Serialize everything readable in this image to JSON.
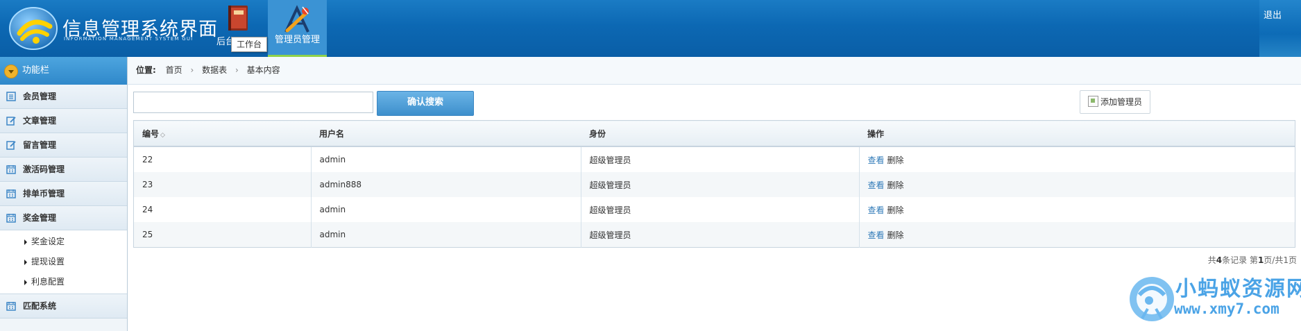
{
  "header": {
    "title": "信息管理系统界面",
    "subtitle": "INFORMATION MANAGEMENT SYSTEM GUI",
    "nav": [
      {
        "label": "后台",
        "icon": "book-icon"
      },
      {
        "label": "管理员管理",
        "icon": "tools-icon",
        "active": true
      }
    ],
    "tooltip": "工作台",
    "logout": "退出"
  },
  "sidebar": {
    "title": "功能栏",
    "items": [
      {
        "label": "会员管理",
        "icon": "list-icon"
      },
      {
        "label": "文章管理",
        "icon": "edit-icon"
      },
      {
        "label": "留言管理",
        "icon": "edit-icon"
      },
      {
        "label": "激活码管理",
        "icon": "calendar-icon"
      },
      {
        "label": "排单币管理",
        "icon": "calendar-icon"
      },
      {
        "label": "奖金管理",
        "icon": "calendar-icon"
      }
    ],
    "sub_items": [
      "奖金设定",
      "提现设置",
      "利息配置"
    ],
    "last_item": {
      "label": "匹配系统",
      "icon": "calendar-icon"
    }
  },
  "breadcrumb": {
    "label": "位置:",
    "items": [
      "首页",
      "数据表",
      "基本内容"
    ]
  },
  "search": {
    "placeholder": "",
    "button": "确认搜索"
  },
  "add_button": "添加管理员",
  "table": {
    "headers": [
      "编号",
      "用户名",
      "身份",
      "操作"
    ],
    "rows": [
      {
        "id": "22",
        "username": "admin",
        "role": "超级管理员",
        "view": "查看",
        "del": "删除"
      },
      {
        "id": "23",
        "username": "admin888",
        "role": "超级管理员",
        "view": "查看",
        "del": "删除"
      },
      {
        "id": "24",
        "username": "admin",
        "role": "超级管理员",
        "view": "查看",
        "del": "删除"
      },
      {
        "id": "25",
        "username": "admin",
        "role": "超级管理员",
        "view": "查看",
        "del": "删除"
      }
    ]
  },
  "pager": {
    "prefix": "共",
    "total": "4",
    "mid": "条记录 第",
    "page": "1",
    "sep": "页/共",
    "pages": "1",
    "suffix": "页"
  },
  "watermark": {
    "title": "小蚂蚁资源网",
    "url": "www.xmy7.com"
  },
  "colors": {
    "header": "#0c68b3",
    "accent": "#3d8fcc",
    "link": "#2f7ab8"
  }
}
